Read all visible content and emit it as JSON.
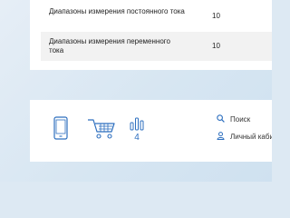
{
  "specs": {
    "rows": [
      {
        "label": "Диапазоны измерения постоянного тока",
        "value": "10"
      },
      {
        "label": "Диапазоны измерения переменного тока",
        "value": "10"
      }
    ]
  },
  "toolbar": {
    "phone_icon": "phone-icon",
    "cart_icon": "cart-icon",
    "compare_icon": "compare-bars-icon",
    "compare_count": "4",
    "search_label": "Поиск",
    "account_label": "Личный каби"
  },
  "colors": {
    "accent": "#2d6fbf",
    "background": "#dde9f3"
  }
}
